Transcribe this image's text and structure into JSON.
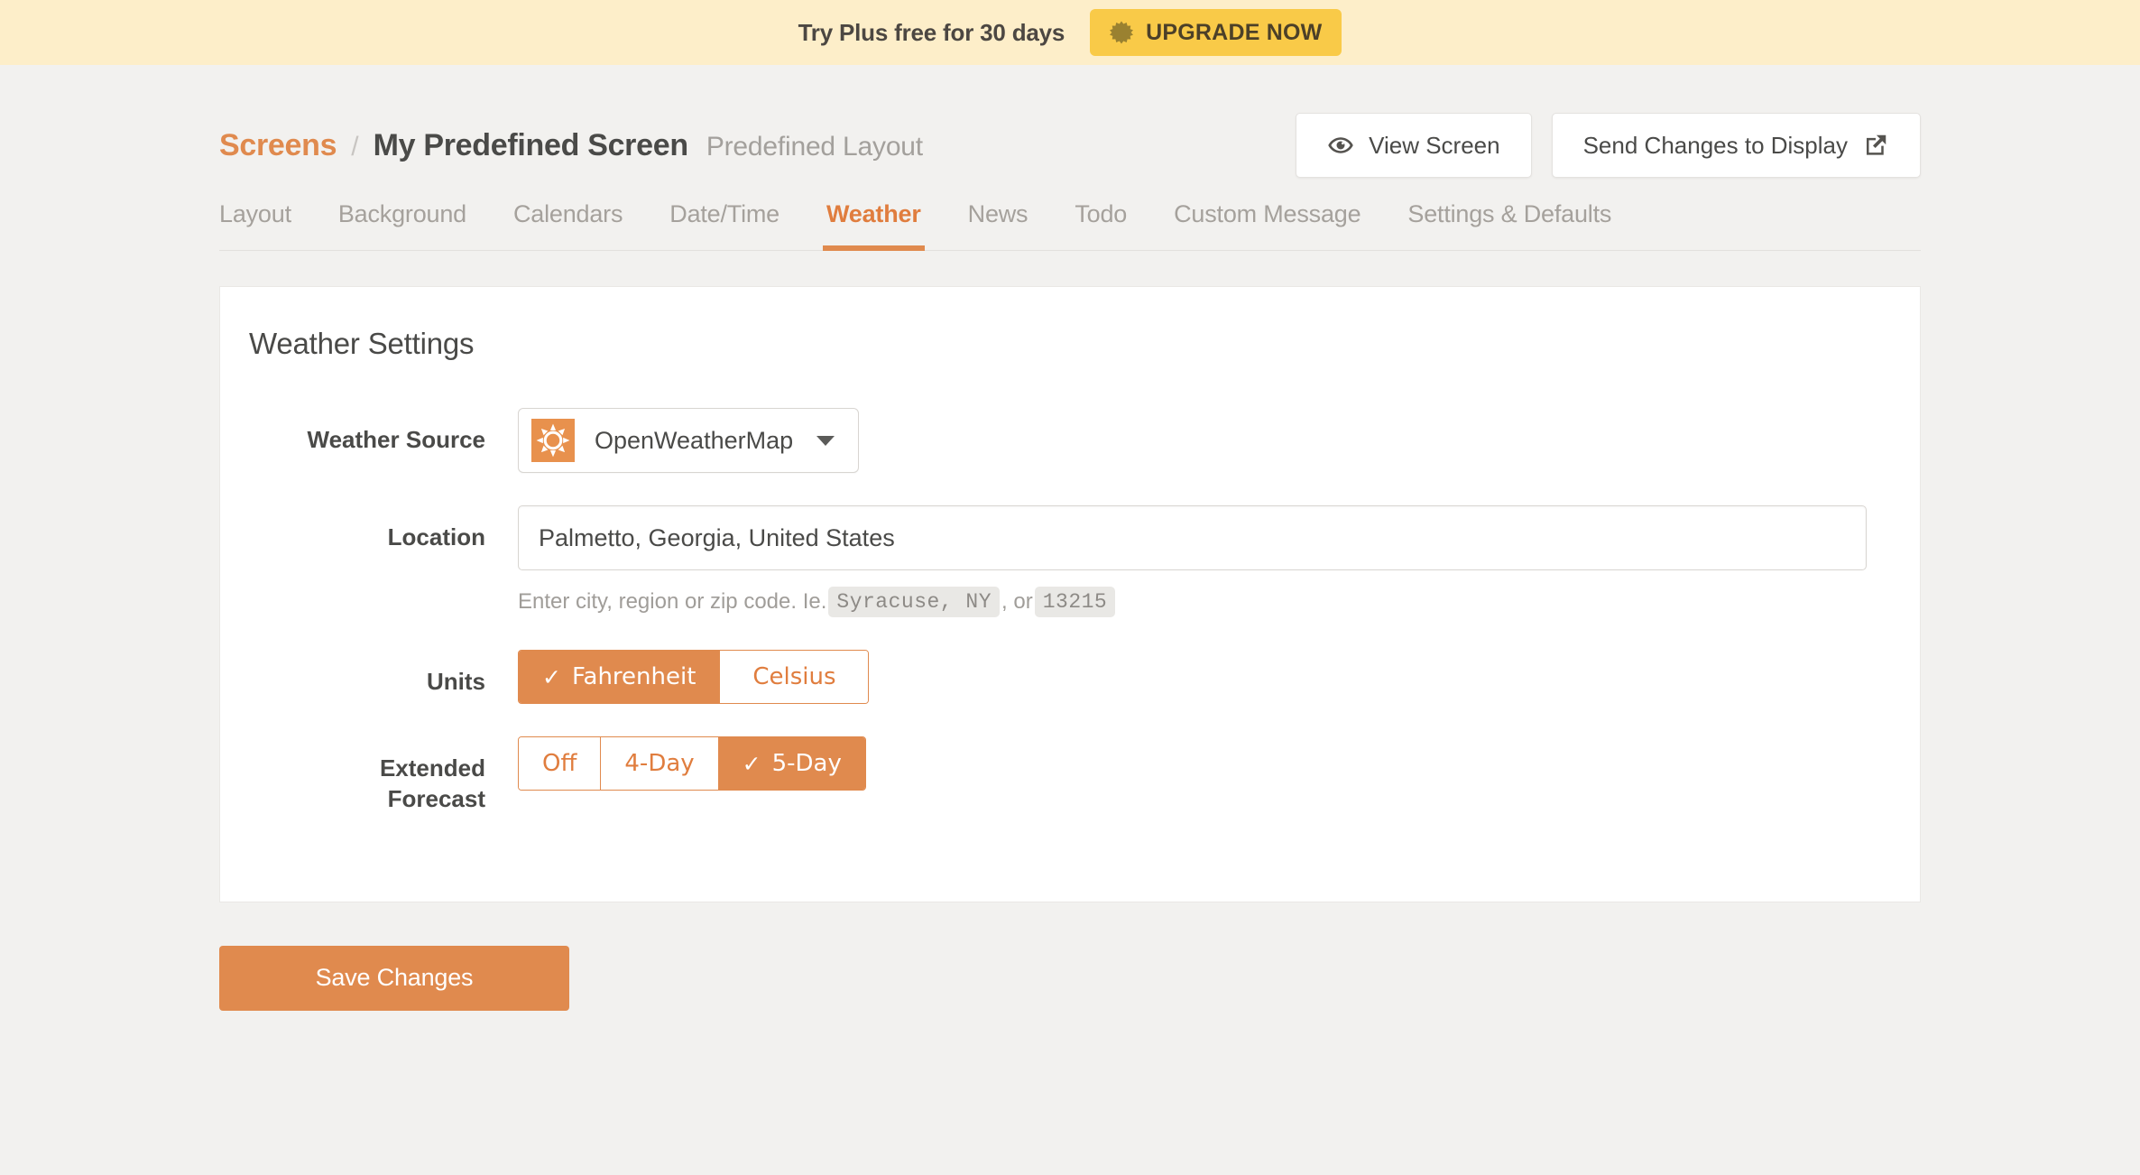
{
  "promo": {
    "text": "Try Plus free for 30 days",
    "button_label": "UPGRADE NOW",
    "button_icon": "burst-icon",
    "bg_color": "#fdeec9",
    "button_color": "#f9ca48"
  },
  "header": {
    "breadcrumb_link": "Screens",
    "breadcrumb_separator": "/",
    "title": "My Predefined Screen",
    "subtitle": "Predefined Layout",
    "actions": [
      {
        "label": "View Screen",
        "icon": "eye-icon"
      },
      {
        "label": "Send Changes to Display",
        "icon": "external-link-icon"
      }
    ]
  },
  "tabs": [
    {
      "label": "Layout",
      "active": false
    },
    {
      "label": "Background",
      "active": false
    },
    {
      "label": "Calendars",
      "active": false
    },
    {
      "label": "Date/Time",
      "active": false
    },
    {
      "label": "Weather",
      "active": true
    },
    {
      "label": "News",
      "active": false
    },
    {
      "label": "Todo",
      "active": false
    },
    {
      "label": "Custom Message",
      "active": false
    },
    {
      "label": "Settings & Defaults",
      "active": false
    }
  ],
  "card": {
    "title": "Weather Settings",
    "weather_source": {
      "label": "Weather Source",
      "value": "OpenWeatherMap",
      "icon": "sun-icon"
    },
    "location": {
      "label": "Location",
      "value": "Palmetto, Georgia, United States",
      "placeholder": "Enter city, region or zip code",
      "help_prefix": "Enter city, region or zip code. Ie.",
      "help_code_1": "Syracuse, NY",
      "help_middle": ", or",
      "help_code_2": "13215"
    },
    "units": {
      "label": "Units",
      "options": [
        {
          "label": "Fahrenheit",
          "selected": true
        },
        {
          "label": "Celsius",
          "selected": false
        }
      ]
    },
    "extended_forecast": {
      "label": "Extended Forecast",
      "label_line_1": "Extended",
      "label_line_2": "Forecast",
      "options": [
        {
          "label": "Off",
          "selected": false
        },
        {
          "label": "4-Day",
          "selected": false
        },
        {
          "label": "5-Day",
          "selected": true
        }
      ]
    }
  },
  "save_button": {
    "label": "Save Changes"
  },
  "theme": {
    "accent": "#e08a4e",
    "page_bg": "#f2f1ef",
    "text": "#4a4a48",
    "muted": "#a5a19c"
  },
  "check_glyph": "✓"
}
